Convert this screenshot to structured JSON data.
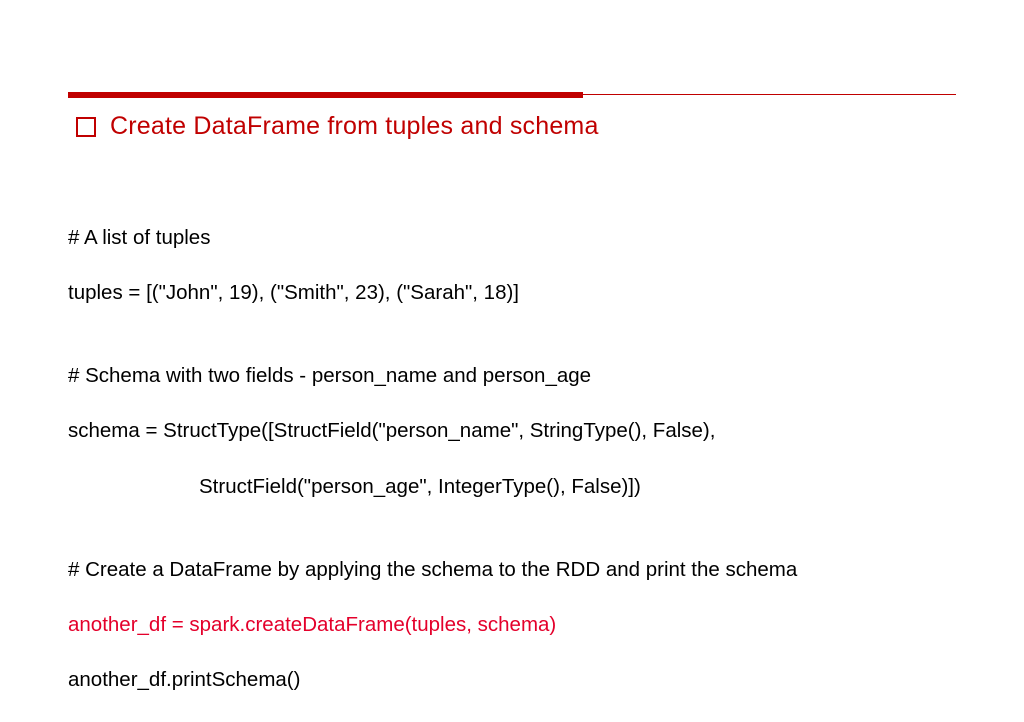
{
  "heading": "Create DataFrame from tuples and schema",
  "code": {
    "l1": "# A list of tuples",
    "l2": "tuples = [(\"John\", 19), (\"Smith\", 23), (\"Sarah\", 18)]",
    "l3": "",
    "l4": "# Schema with two fields - person_name and person_age",
    "l5": "schema = StructType([StructField(\"person_name\", StringType(), False),",
    "l6": "                       StructField(\"person_age\", IntegerType(), False)])",
    "l7": "",
    "l8": "# Create a DataFrame by applying the schema to the RDD and print the schema",
    "l9": "another_df = spark.createDataFrame(tuples, schema)",
    "l10": "another_df.printSchema()"
  },
  "colors": {
    "accent": "#c00000",
    "highlight": "#e4002b"
  }
}
